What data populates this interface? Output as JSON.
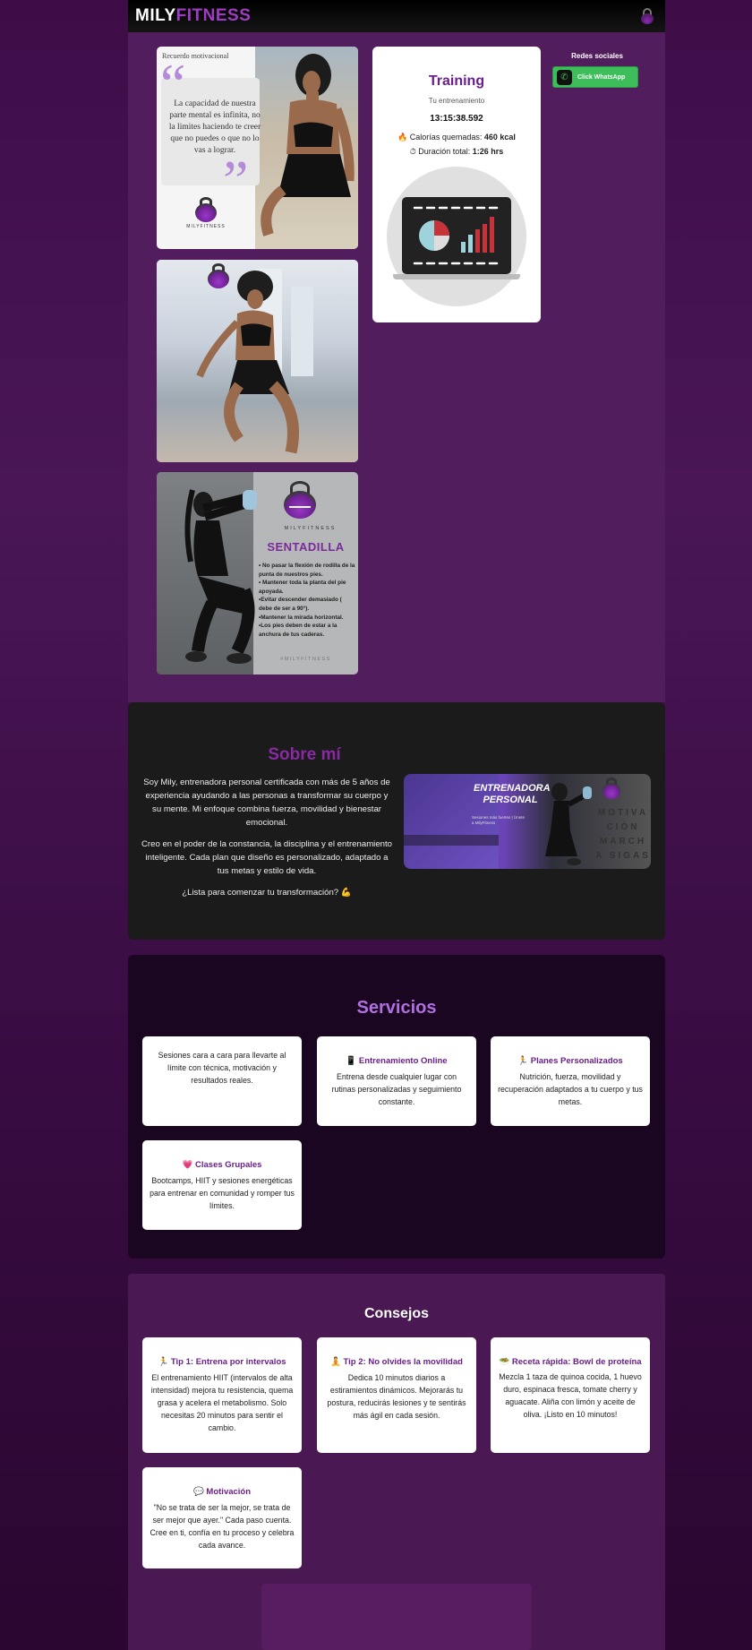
{
  "header": {
    "logo_part1": "MILY",
    "logo_part2": "FITNESS",
    "icon": "kettlebell-icon"
  },
  "gallery": {
    "quote_label": "Recuerdo motivacional",
    "quote_text": "La capacidad de nuestra parte mental es infinita, no la limites haciendo te creer que no puedes o que no lo vas a lograr.",
    "brand_label": "MILYFITNESS",
    "squat_brand": "MILYFITNESS",
    "squat_title": "SENTADILLA",
    "squat_tips": [
      "• No pasar la flexión de rodilla de la punta de nuestros pies.",
      "• Mantener toda la planta del pie apoyada.",
      "•Evitar descender demasiado ( debe de ser a 90°).",
      "•Mantener la mirada horizontal.",
      "•Los pies deben de estar a la anchura de tus caderas."
    ],
    "squat_hashtag": "#MILYFITNESS"
  },
  "training": {
    "title": "Training",
    "subtitle": "Tu entrenamiento",
    "timer": "13:15:38.592",
    "calories_label": "🔥 Calorías quemadas: ",
    "calories_value": "460 kcal",
    "duration_label": "⏱ Duración total: ",
    "duration_value": "1:26 hrs"
  },
  "social": {
    "title": "Redes sociales",
    "whatsapp_label": "Click WhatsApp"
  },
  "about": {
    "title": "Sobre mí",
    "paragraphs": [
      "Soy Mily, entrenadora personal certificada con más de 5 años de experiencia ayudando a las personas a transformar su cuerpo y su mente. Mi enfoque combina fuerza, movilidad y bienestar emocional.",
      "Creo en el poder de la constancia, la disciplina y el entrenamiento inteligente. Cada plan que diseño es personalizado, adaptado a tus metas y estilo de vida.",
      "¿Lista para comenzar tu transformación? 💪"
    ],
    "banner_title_line1": "ENTRENADORA",
    "banner_title_line2": "PERSONAL",
    "banner_small": "Sesiones más fuertes | Únete a MilyFitness",
    "banner_side": "MOTIVACIÓN MARCHA SIGAS"
  },
  "services": {
    "title": "Servicios",
    "cards": [
      {
        "title": "",
        "desc": "Sesiones cara a cara para llevarte al límite con técnica, motivación y resultados reales."
      },
      {
        "title": "📱 Entrenamiento Online",
        "desc": "Entrena desde cualquier lugar con rutinas personalizadas y seguimiento constante."
      },
      {
        "title": "🏃 Planes Personalizados",
        "desc": "Nutrición, fuerza, movilidad y recuperación adaptados a tu cuerpo y tus metas."
      },
      {
        "title": "💗 Clases Grupales",
        "desc": "Bootcamps, HIIT y sesiones energéticas para entrenar en comunidad y romper tus límites."
      }
    ]
  },
  "advice": {
    "title": "Consejos",
    "cards": [
      {
        "title": "🏃 Tip 1: Entrena por intervalos",
        "desc": "El entrenamiento HIIT (intervalos de alta intensidad) mejora tu resistencia, quema grasa y acelera el metabolismo. Solo necesitas 20 minutos para sentir el cambio."
      },
      {
        "title": "🧘 Tip 2: No olvides la movilidad",
        "desc": "Dedica 10 minutos diarios a estiramientos dinámicos. Mejorarás tu postura, reducirás lesiones y te sentirás más ágil en cada sesión."
      },
      {
        "title": "🥗 Receta rápida: Bowl de proteína",
        "desc": "Mezcla 1 taza de quinoa cocida, 1 huevo duro, espinaca fresca, tomate cherry y aguacate. Aliña con limón y aceite de oliva. ¡Listo en 10 minutos!"
      },
      {
        "title": "💬 Motivación",
        "desc": "\"No se trata de ser la mejor, se trata de ser mejor que ayer.\" Cada paso cuenta. Cree en ti, confía en tu proceso y celebra cada avance."
      }
    ]
  },
  "colors": {
    "accent": "#6b1f8c",
    "whatsapp": "#3dbe5a",
    "background": "#3e0d48"
  }
}
